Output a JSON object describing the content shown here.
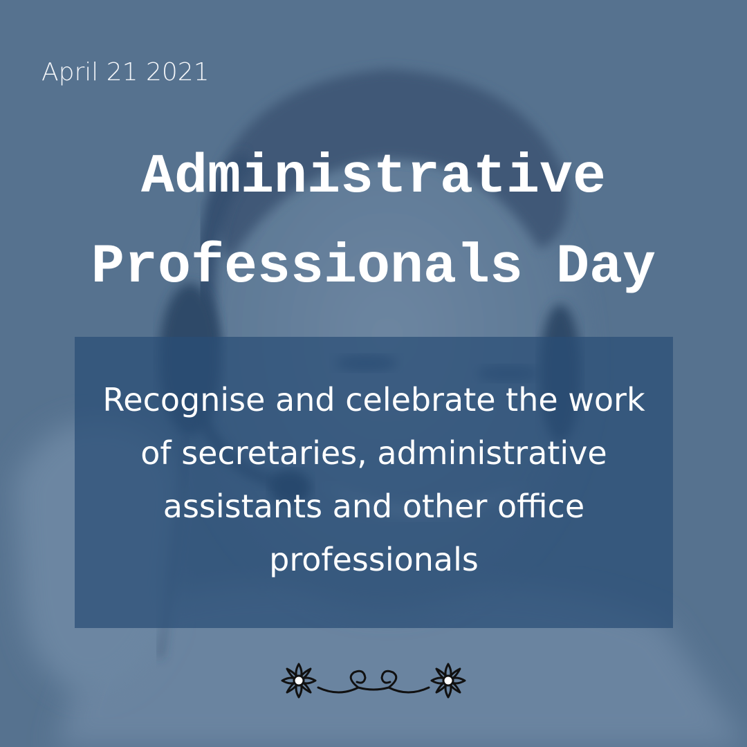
{
  "date": "April 21 2021",
  "title_line1": "Administrative",
  "title_line2": "Professionals Day",
  "message": "Recognise and celebrate the work of secretaries, administrative assistants and other office professionals",
  "colors": {
    "background": "#56728f",
    "box": "#2a4e76",
    "text": "#ffffff",
    "ornament": "#111111"
  },
  "icons": [
    "headset-person-photo",
    "flourish-ornament-icon"
  ]
}
